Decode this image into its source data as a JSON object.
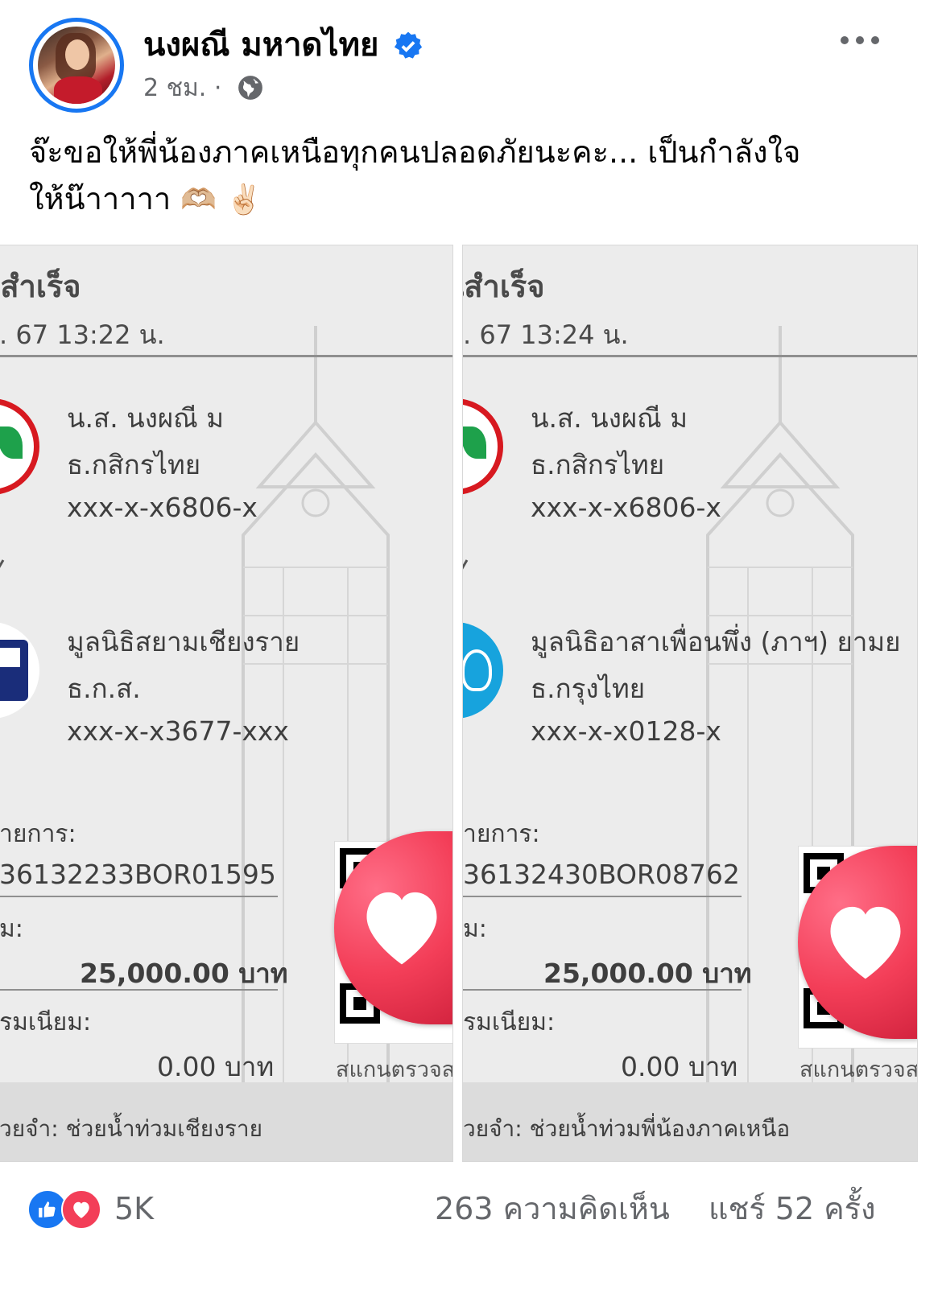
{
  "post": {
    "author_name": "นงผณี มหาดไทย",
    "timestamp": "2 ชม.",
    "separator": "·",
    "text_line1": "จ๊ะขอให้พี่น้องภาคเหนือทุกคนปลอดภัยนะคะ... เป็นกำลังใจ",
    "text_line2": "ให้น๊าาาาา",
    "emojis": "🫶🏼 ✌🏻"
  },
  "slips": [
    {
      "title": "ำเร็จ",
      "title_full": "วันสำเร็จ",
      "datetime": ". 67  13:22 น.",
      "sender_name": "น.ส. นงผณี ม",
      "sender_bank": "ธ.กสิกรไทย",
      "sender_account": "xxx-x-x6806-x",
      "receiver_name": "มูลนิธิสยามเชียงราย",
      "receiver_bank": "ธ.ก.ส.",
      "receiver_account": "xxx-x-x3677-xxx",
      "ref_label": "ายการ:",
      "ref_value": "36132233BOR01595",
      "amount_label": "ม:",
      "amount_value": "25,000.00 บาท",
      "fee_label": "รมเนียม:",
      "fee_value": "0.00 บาท",
      "scan_text": "สแกนตรวจส",
      "memo": "่วยจำ: ช่วยน้ำท่วมเชียงราย"
    },
    {
      "title": "ำเร็จ",
      "title_full": "วันสำเร็จ",
      "datetime": ". 67  13:24 น.",
      "sender_name": "น.ส. นงผณี ม",
      "sender_bank": "ธ.กสิกรไทย",
      "sender_account": "xxx-x-x6806-x",
      "receiver_name": "มูลนิธิอาสาเพื่อนพึ่ง (ภาฯ) ยามย",
      "receiver_bank": "ธ.กรุงไทย",
      "receiver_account": "xxx-x-x0128-x",
      "ref_label": "ายการ:",
      "ref_value": "36132430BOR08762",
      "amount_label": "ม:",
      "amount_value": "25,000.00 บาท",
      "fee_label": "รมเนียม:",
      "fee_value": "0.00 บาท",
      "scan_text": "สแกนตรวจส",
      "memo": "่วยจำ: ช่วยน้ำท่วมพี่น้องภาคเหนือ"
    }
  ],
  "stats": {
    "reactions_count": "5K",
    "comments": "263 ความคิดเห็น",
    "shares": "แชร์ 52 ครั้ง"
  },
  "colors": {
    "accent": "#1877f2",
    "love": "#f33e58",
    "kbank": "#d71920",
    "ktb": "#17a3dd",
    "baac": "#1a2d7a"
  },
  "icons": {
    "verified": "verified-badge-icon",
    "privacy": "globe-icon",
    "menu": "more-dots-icon",
    "like": "like-icon",
    "love": "love-icon"
  }
}
